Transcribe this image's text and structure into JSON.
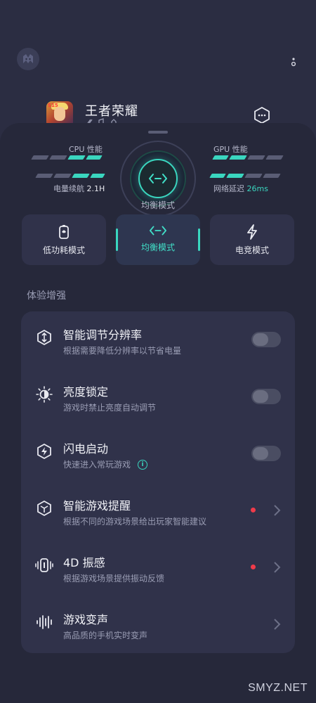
{
  "header": {
    "app_logo_icon": "game-space-logo-icon",
    "more_icon": "more-vertical-icon"
  },
  "game": {
    "title": "王者荣耀",
    "subtitle": "⟋ ⌂ ⚘",
    "settings_icon": "hexagon-more-icon"
  },
  "performance": {
    "cpu_label": "CPU 性能",
    "gpu_label": "GPU 性能",
    "battery_label": "电量续航",
    "battery_value": "2.1H",
    "latency_label": "网络延迟",
    "latency_value": "26ms",
    "current_mode": "均衡模式",
    "cpu_level": 0.5,
    "gpu_level": 0.5,
    "accent_color": "#3ad6bf"
  },
  "modes": [
    {
      "label": "低功耗模式",
      "icon": "battery-saver-icon",
      "active": false
    },
    {
      "label": "均衡模式",
      "icon": "balance-mode-icon",
      "active": true
    },
    {
      "label": "电竞模式",
      "icon": "lightning-icon",
      "active": false
    }
  ],
  "section": {
    "title": "体验增强"
  },
  "features": [
    {
      "title": "智能调节分辨率",
      "desc": "根据需要降低分辨率以节省电量",
      "control": "toggle",
      "on": false,
      "icon": "resolution-icon"
    },
    {
      "title": "亮度锁定",
      "desc": "游戏时禁止亮度自动调节",
      "control": "toggle",
      "on": false,
      "icon": "brightness-icon"
    },
    {
      "title": "闪电启动",
      "desc": "快速进入常玩游戏",
      "control": "toggle",
      "on": false,
      "icon": "flash-launch-icon",
      "info": "i"
    },
    {
      "title": "智能游戏提醒",
      "desc": "根据不同的游戏场景给出玩家智能建议",
      "control": "chevron",
      "badge": true,
      "icon": "smart-reminder-icon"
    },
    {
      "title": "4D 振感",
      "desc": "根据游戏场景提供振动反馈",
      "control": "chevron",
      "badge": true,
      "icon": "vibration-icon"
    },
    {
      "title": "游戏变声",
      "desc": "高品质的手机实时变声",
      "control": "chevron",
      "badge": false,
      "icon": "voice-changer-icon"
    }
  ],
  "watermark": "SMYZ.NET"
}
